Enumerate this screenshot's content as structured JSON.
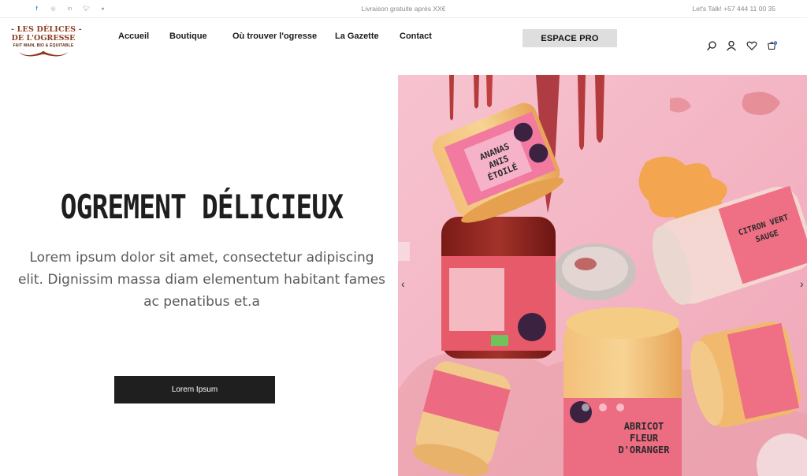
{
  "topbar": {
    "social": [
      "facebook-icon",
      "instagram-icon",
      "linkedin-icon",
      "twitter-icon",
      "pinterest-icon"
    ],
    "promo": "Livraison gratuite  après XX€",
    "phone": "Let's Talk! +57 444 11 00 35"
  },
  "logo": {
    "line1": "- LES DÉLICES -",
    "line2": "DE L'OGRESSE",
    "line3": "FAIT MAIN, BIO & ÉQUITABLE"
  },
  "nav": [
    "Accueil",
    "Boutique",
    "Où trouver l'ogresse",
    "La Gazette",
    "Contact"
  ],
  "pro_button": "ESPACE PRO",
  "header_icons": [
    "search-icon",
    "user-icon",
    "heart-icon",
    "cart-icon"
  ],
  "cart_count": "0",
  "hero": {
    "title": "OGREMENT DÉLICIEUX",
    "text": "Lorem ipsum dolor sit amet, consectetur adipiscing elit. Dignissim massa diam elementum habitant fames ac penatibus et.a",
    "button": "Lorem Ipsum",
    "image_jars": [
      "ANANAS ANIS ÉTOILE",
      "ANANAS CITRON VERT SAUGE",
      "ABRICOT FLEUR D'ORANGER"
    ],
    "arrow_prev": "‹",
    "arrow_next": "›",
    "slide_count": 3
  },
  "colors": {
    "brand": "#8c3a1c",
    "hero_bg": "#f4b3c2",
    "button_dark": "#1f1f1f",
    "pro_button_bg": "#dedede"
  }
}
